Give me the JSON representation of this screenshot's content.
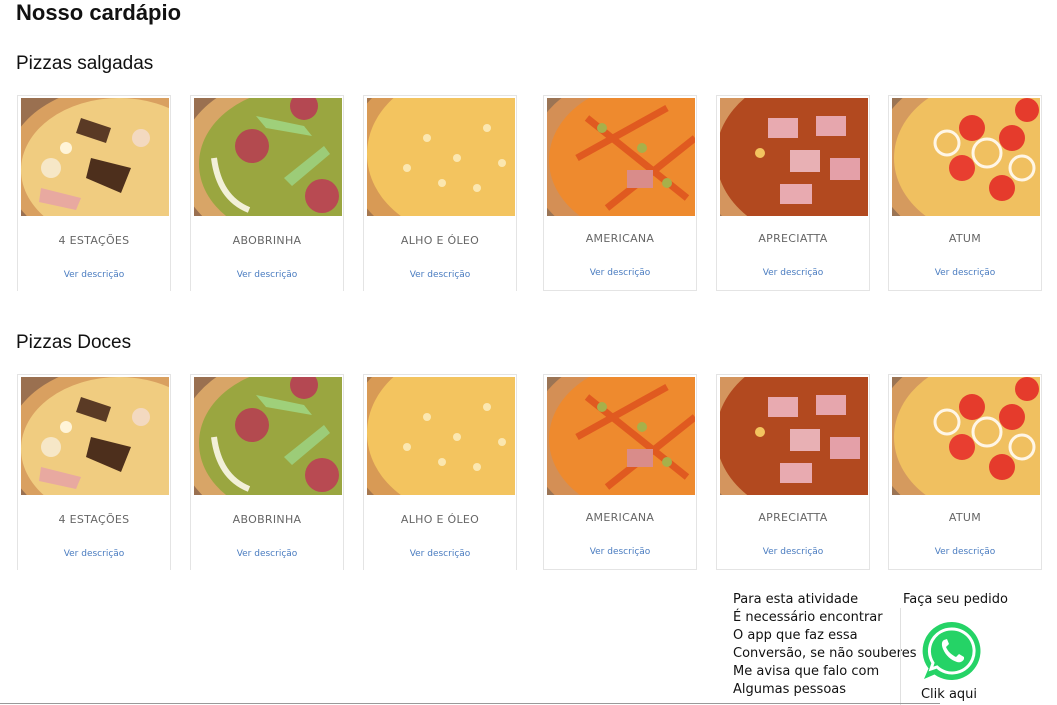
{
  "page_title": "Nosso cardápio",
  "sections": [
    {
      "title": "Pizzas salgadas",
      "items": [
        {
          "name": "4 ESTAÇÕES",
          "link": "Ver descrição",
          "image": "pizza-4-estacoes-image"
        },
        {
          "name": "ABOBRINHA",
          "link": "Ver descrição",
          "image": "pizza-abobrinha-image"
        },
        {
          "name": "ALHO E ÓLEO",
          "link": "Ver descrição",
          "image": "pizza-alho-e-oleo-image"
        },
        {
          "name": "AMERICANA",
          "link": "Ver descrição",
          "image": "pizza-americana-image"
        },
        {
          "name": "APRECIATTA",
          "link": "Ver descrição",
          "image": "pizza-apreciatta-image"
        },
        {
          "name": "ATUM",
          "link": "Ver descrição",
          "image": "pizza-atum-image"
        }
      ]
    },
    {
      "title": "Pizzas Doces",
      "items": [
        {
          "name": "4 ESTAÇÕES",
          "link": "Ver descrição",
          "image": "pizza-4-estacoes-image"
        },
        {
          "name": "ABOBRINHA",
          "link": "Ver descrição",
          "image": "pizza-abobrinha-image"
        },
        {
          "name": "ALHO E ÓLEO",
          "link": "Ver descrição",
          "image": "pizza-alho-e-oleo-image"
        },
        {
          "name": "AMERICANA",
          "link": "Ver descrição",
          "image": "pizza-americana-image"
        },
        {
          "name": "APRECIATTA",
          "link": "Ver descrição",
          "image": "pizza-apreciatta-image"
        },
        {
          "name": "ATUM",
          "link": "Ver descrição",
          "image": "pizza-atum-image"
        }
      ]
    }
  ],
  "note_lines": [
    "Para esta atividade",
    "É necessário encontrar",
    "O app que faz essa",
    "Conversão, se não souberes",
    "Me avisa que falo com",
    "Algumas pessoas"
  ],
  "order": {
    "label": "Faça seu pedido",
    "icon": "whatsapp-icon",
    "cta": "Clik aqui"
  },
  "colors": {
    "link": "#4a7cc0",
    "item_name": "#666666",
    "whatsapp": "#25d366"
  }
}
